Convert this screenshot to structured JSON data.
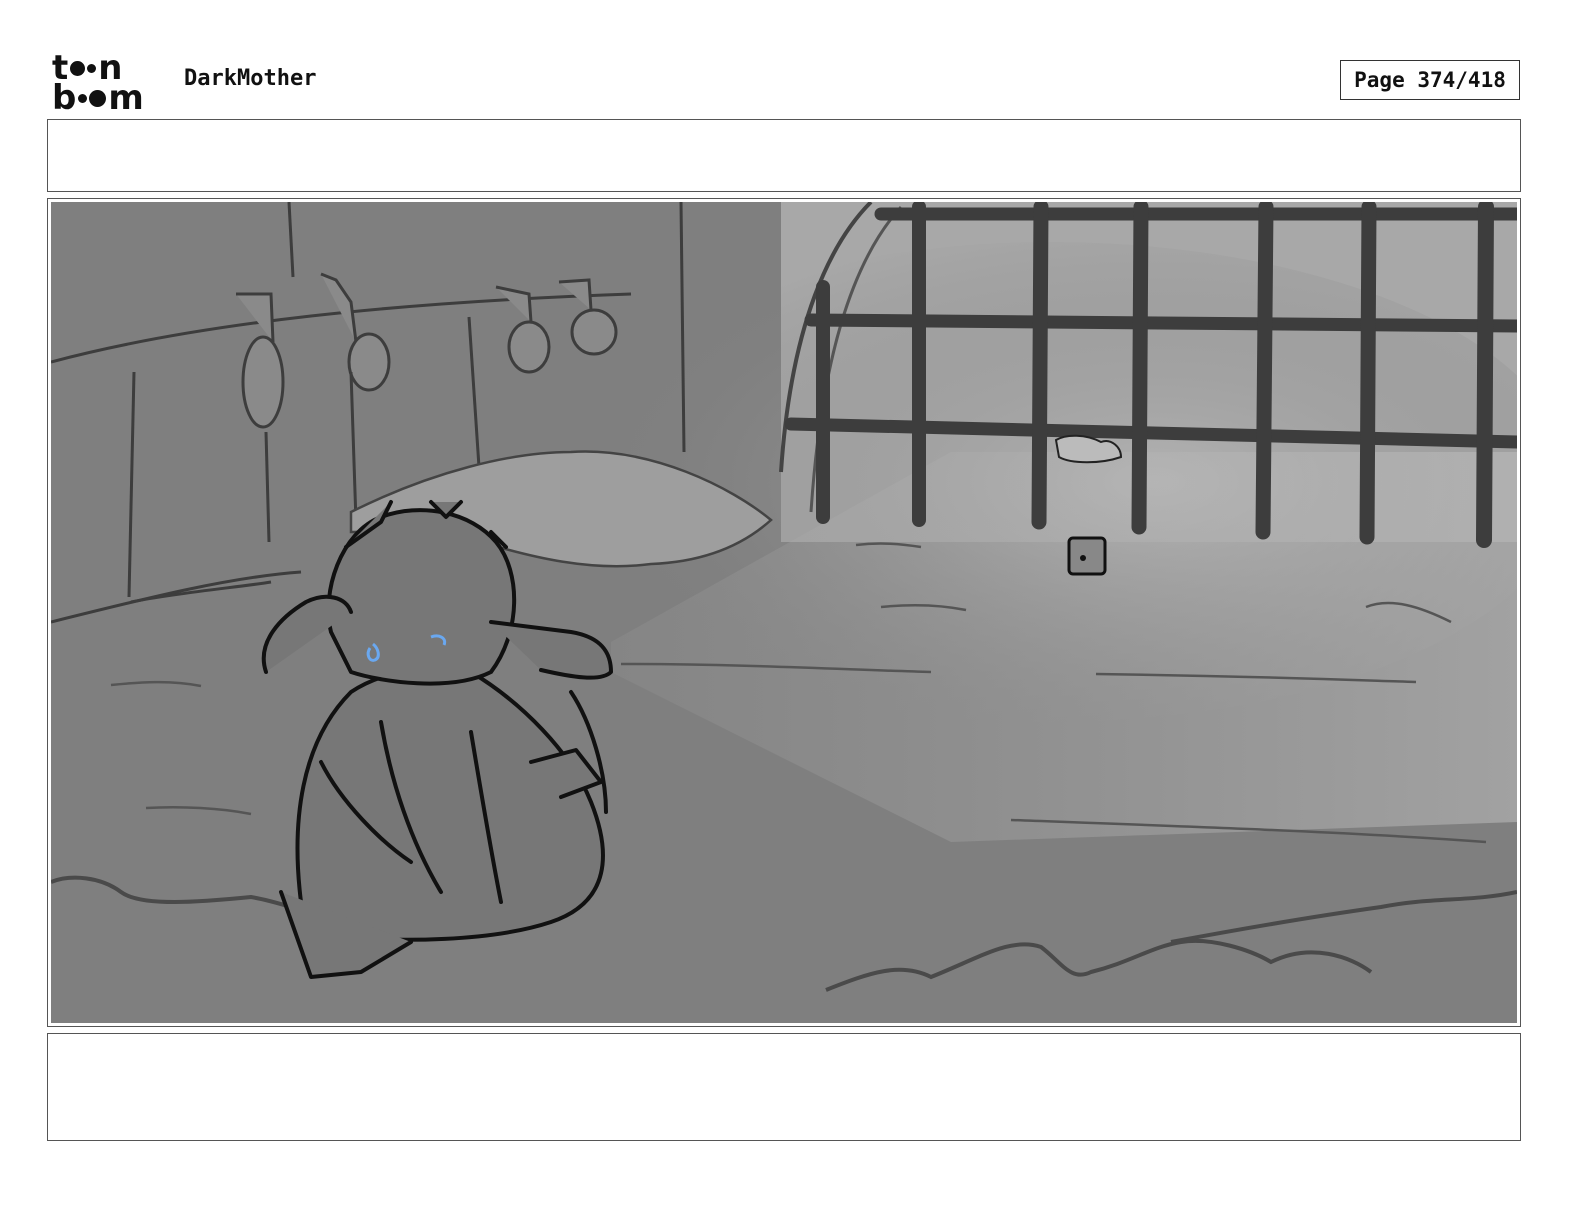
{
  "header": {
    "logo_top": "t",
    "logo_top_end": "n",
    "logo_bottom_start": "b",
    "logo_bottom_end": "m",
    "project_title": "DarkMother",
    "page_label": "Page 374/418"
  },
  "panel": {
    "image_description_icon": "storyboard-sketch",
    "background_color": "#7f7f7f",
    "accent_color": "#6aa8f0"
  },
  "action_text": "",
  "dialogue_text": ""
}
